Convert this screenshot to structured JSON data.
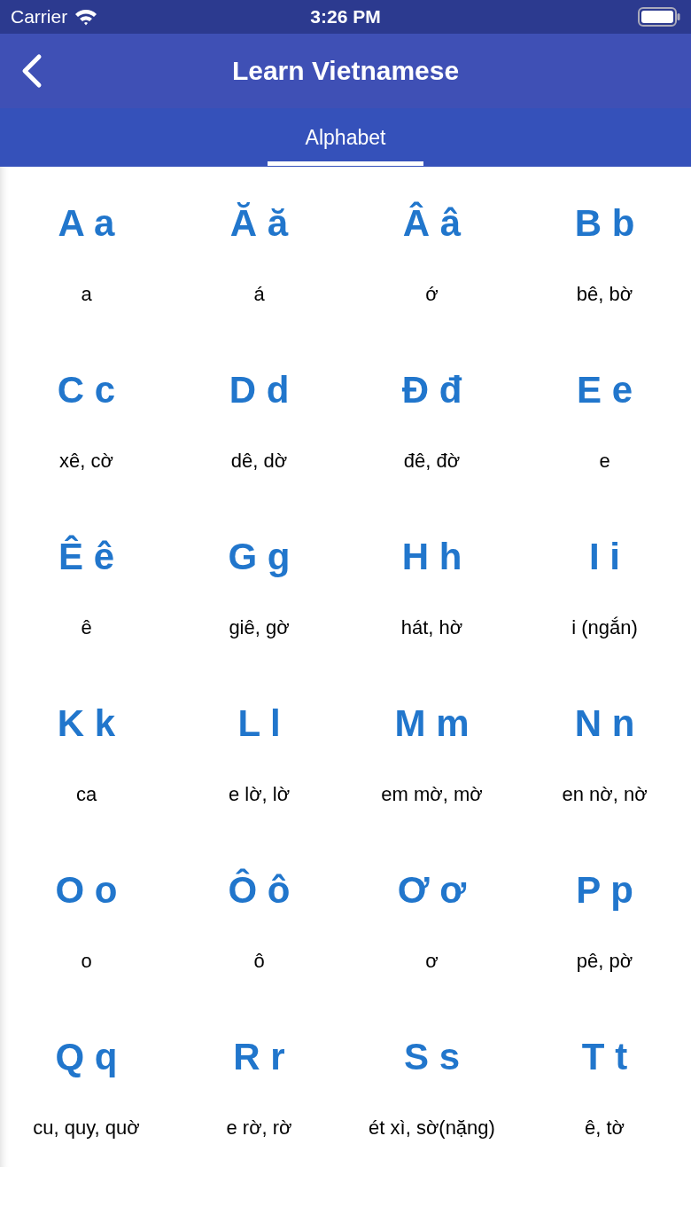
{
  "status_bar": {
    "carrier": "Carrier",
    "time": "3:26 PM"
  },
  "nav": {
    "title": "Learn Vietnamese"
  },
  "tabs": [
    {
      "label": "Alphabet",
      "selected": true
    }
  ],
  "letters": [
    {
      "letter": "A a",
      "pronunciation": "a"
    },
    {
      "letter": "Ă ă",
      "pronunciation": "á"
    },
    {
      "letter": "Â â",
      "pronunciation": "ớ"
    },
    {
      "letter": "B b",
      "pronunciation": "bê, bờ"
    },
    {
      "letter": "C c",
      "pronunciation": "xê, cờ"
    },
    {
      "letter": "D d",
      "pronunciation": "dê, dờ"
    },
    {
      "letter": "Đ đ",
      "pronunciation": "đê, đờ"
    },
    {
      "letter": "E e",
      "pronunciation": "e"
    },
    {
      "letter": "Ê ê",
      "pronunciation": "ê"
    },
    {
      "letter": "G g",
      "pronunciation": "giê, gờ"
    },
    {
      "letter": "H h",
      "pronunciation": "hát, hờ"
    },
    {
      "letter": "I i",
      "pronunciation": "i (ngắn)"
    },
    {
      "letter": "K k",
      "pronunciation": "ca"
    },
    {
      "letter": "L l",
      "pronunciation": "e lờ, lờ"
    },
    {
      "letter": "M m",
      "pronunciation": "em mờ, mờ"
    },
    {
      "letter": "N n",
      "pronunciation": "en nờ, nờ"
    },
    {
      "letter": "O o",
      "pronunciation": "o"
    },
    {
      "letter": "Ô ô",
      "pronunciation": "ô"
    },
    {
      "letter": "Ơ ơ",
      "pronunciation": "ơ"
    },
    {
      "letter": "P p",
      "pronunciation": "pê, pờ"
    },
    {
      "letter": "Q q",
      "pronunciation": "cu, quy, quờ"
    },
    {
      "letter": "R r",
      "pronunciation": "e rờ, rờ"
    },
    {
      "letter": "S s",
      "pronunciation": "ét xì, sờ(nặng)"
    },
    {
      "letter": "T t",
      "pronunciation": "ê, tờ"
    }
  ]
}
